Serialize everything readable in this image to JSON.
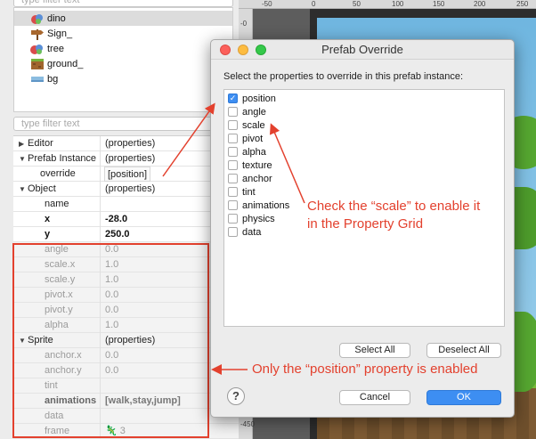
{
  "tree": {
    "filter_placeholder": "type filter text",
    "items": [
      {
        "label": "dino",
        "icon": "dino-sprite-icon"
      },
      {
        "label": "Sign_",
        "icon": "signpost-icon"
      },
      {
        "label": "tree",
        "icon": "tree-sprite-icon"
      },
      {
        "label": "ground_",
        "icon": "ground-tile-icon"
      },
      {
        "label": "bg",
        "icon": "bg-image-icon"
      }
    ]
  },
  "grid": {
    "filter_placeholder": "type filter text",
    "rows": [
      {
        "key": "Editor",
        "value": "(properties)"
      },
      {
        "key": "Prefab Instance",
        "value": "(properties)"
      },
      {
        "key": "override",
        "value": "[position]"
      },
      {
        "key": "Object",
        "value": "(properties)"
      },
      {
        "key": "name",
        "value": ""
      },
      {
        "key": "x",
        "value": "-28.0"
      },
      {
        "key": "y",
        "value": "250.0"
      },
      {
        "key": "angle",
        "value": "0.0"
      },
      {
        "key": "scale.x",
        "value": "1.0"
      },
      {
        "key": "scale.y",
        "value": "1.0"
      },
      {
        "key": "pivot.x",
        "value": "0.0"
      },
      {
        "key": "pivot.y",
        "value": "0.0"
      },
      {
        "key": "alpha",
        "value": "1.0"
      },
      {
        "key": "Sprite",
        "value": "(properties)"
      },
      {
        "key": "anchor.x",
        "value": "0.0"
      },
      {
        "key": "anchor.y",
        "value": "0.0"
      },
      {
        "key": "tint",
        "value": ""
      },
      {
        "key": "animations",
        "value": "[walk,stay,jump]"
      },
      {
        "key": "data",
        "value": ""
      },
      {
        "key": "frame",
        "value": "3"
      }
    ]
  },
  "ruler": {
    "top": [
      "-50",
      "0",
      "50",
      "100",
      "150",
      "200",
      "250"
    ],
    "left": [
      "-0",
      "-450"
    ]
  },
  "dialog": {
    "title": "Prefab Override",
    "prompt": "Select the properties to override in this prefab instance:",
    "properties": [
      {
        "label": "position",
        "checked": true
      },
      {
        "label": "angle",
        "checked": false
      },
      {
        "label": "scale",
        "checked": false
      },
      {
        "label": "pivot",
        "checked": false
      },
      {
        "label": "alpha",
        "checked": false
      },
      {
        "label": "texture",
        "checked": false
      },
      {
        "label": "anchor",
        "checked": false
      },
      {
        "label": "tint",
        "checked": false
      },
      {
        "label": "animations",
        "checked": false
      },
      {
        "label": "physics",
        "checked": false
      },
      {
        "label": "data",
        "checked": false
      }
    ],
    "select_all": "Select All",
    "deselect_all": "Deselect All",
    "cancel": "Cancel",
    "ok": "OK",
    "help": "?"
  },
  "annotations": {
    "scale_note_line1": "Check the “scale” to enable it",
    "scale_note_line2": "in the Property Grid",
    "position_note": "Only the “position” property is enabled"
  },
  "colors": {
    "accent": "#3d8ef2",
    "annotation": "#e3412e"
  }
}
